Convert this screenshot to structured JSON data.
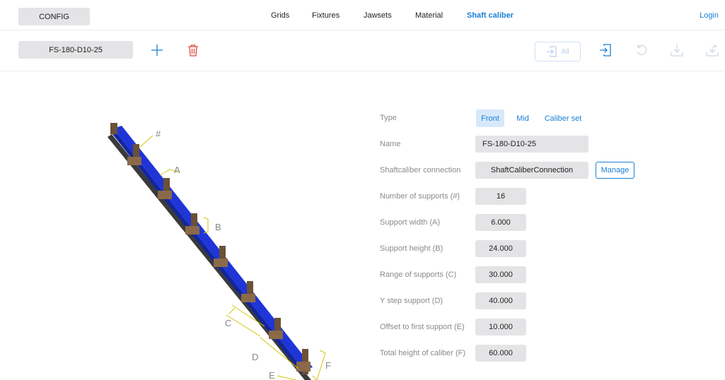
{
  "header": {
    "config_label": "CONFIG",
    "nav": [
      {
        "label": "Grids"
      },
      {
        "label": "Fixtures"
      },
      {
        "label": "Jawsets"
      },
      {
        "label": "Material"
      },
      {
        "label": "Shaft caliber",
        "active": true
      }
    ],
    "login_label": "Login"
  },
  "toolbar": {
    "current_name": "FS-180-D10-25",
    "all_label": "All"
  },
  "diagram": {
    "labels": [
      "#",
      "A",
      "B",
      "C",
      "D",
      "E",
      "F"
    ]
  },
  "form": {
    "type": {
      "label": "Type",
      "options": [
        "Front",
        "Mid",
        "Caliber set"
      ],
      "selected": "Front"
    },
    "name": {
      "label": "Name",
      "value": "FS-180-D10-25"
    },
    "connection": {
      "label": "Shaftcaliber connection",
      "value": "ShaftCaliberConnection",
      "manage_label": "Manage"
    },
    "fields": [
      {
        "label": "Number of supports (#)",
        "value": "16"
      },
      {
        "label": "Support width (A)",
        "value": "6.000"
      },
      {
        "label": "Support height (B)",
        "value": "24.000"
      },
      {
        "label": "Range of supports (C)",
        "value": "30.000"
      },
      {
        "label": "Y step support (D)",
        "value": "40.000"
      },
      {
        "label": "Offset to first support (E)",
        "value": "10.000"
      },
      {
        "label": "Total height of caliber (F)",
        "value": "60.000"
      }
    ]
  },
  "colors": {
    "accent": "#1a7fd6",
    "delete": "#e0493f",
    "rail": "#1f35d8",
    "support": "#6b5136",
    "dimension": "#d4c50a"
  }
}
